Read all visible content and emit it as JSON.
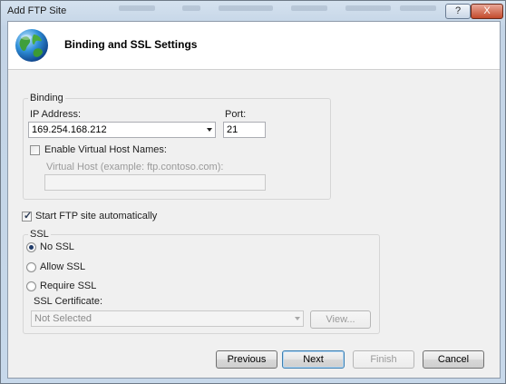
{
  "window": {
    "title": "Add FTP Site",
    "help_label": "?",
    "close_label": "X"
  },
  "header": {
    "title": "Binding and SSL Settings",
    "icon": "globe-icon"
  },
  "binding": {
    "group_label": "Binding",
    "ip_label": "IP Address:",
    "ip_value": "169.254.168.212",
    "port_label": "Port:",
    "port_value": "21",
    "virtual_hosts_label": "Enable Virtual Host Names:",
    "virtual_hosts_checked": false,
    "virtual_host_label": "Virtual Host (example: ftp.contoso.com):",
    "virtual_host_value": ""
  },
  "start_automatically": {
    "label": "Start FTP site automatically",
    "checked": true
  },
  "ssl": {
    "group_label": "SSL",
    "options": [
      "No SSL",
      "Allow SSL",
      "Require SSL"
    ],
    "selected": "No SSL",
    "certificate_label": "SSL Certificate:",
    "certificate_value": "Not Selected",
    "view_label": "View..."
  },
  "buttons": {
    "previous": "Previous",
    "next": "Next",
    "finish": "Finish",
    "cancel": "Cancel"
  },
  "colors": {
    "title_bar": "#c7d8ea",
    "client_bg": "#f0f0f0",
    "accent_border": "#3c7fb1",
    "disabled_text": "#9a9a9a"
  }
}
